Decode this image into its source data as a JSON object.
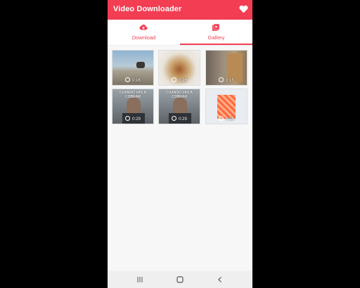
{
  "app": {
    "title": "Video Downloader"
  },
  "tabs": [
    {
      "label": "Download",
      "icon": "cloud-download-icon",
      "active": false
    },
    {
      "label": "Gallery",
      "icon": "video-library-icon",
      "active": true
    }
  ],
  "gallery": {
    "items": [
      {
        "duration": "0:16",
        "caption": ""
      },
      {
        "duration": "0:26",
        "caption": ""
      },
      {
        "duration": "0:15",
        "caption": ""
      },
      {
        "duration": "0:29",
        "caption": "CUANDO VAS A COBRAR"
      },
      {
        "duration": "0:29",
        "caption": "CUANDO VAS A COBRAR"
      },
      {
        "duration": "0:36",
        "caption": ""
      }
    ]
  },
  "colors": {
    "accent": "#f23d53",
    "background": "#f7f7f7"
  },
  "navbar": {
    "buttons": [
      "recent-apps-icon",
      "home-icon",
      "back-icon"
    ]
  }
}
